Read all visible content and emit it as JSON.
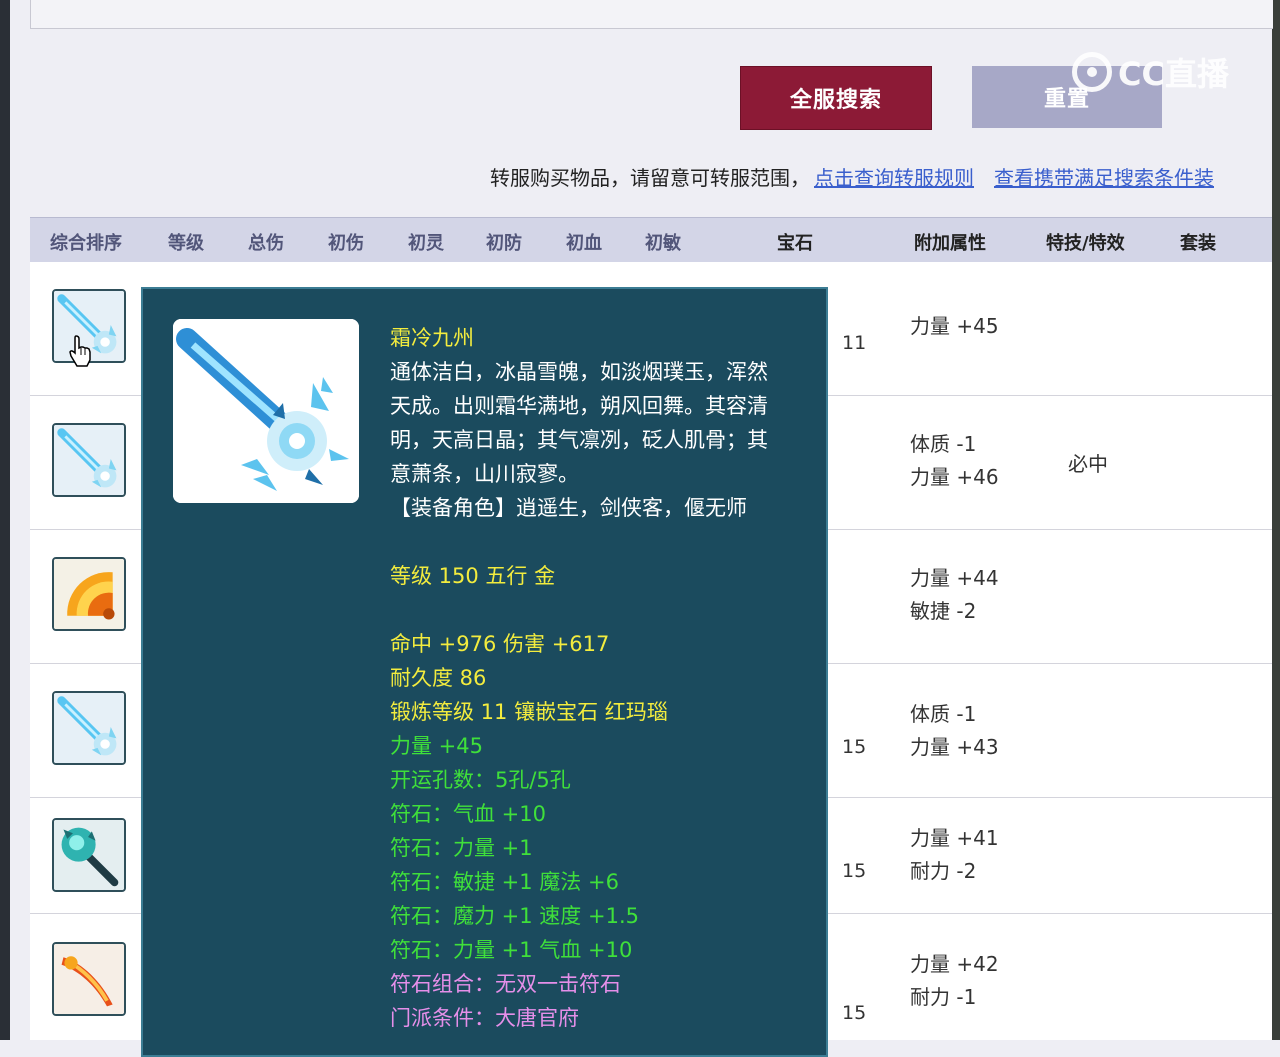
{
  "buttons": {
    "search": "全服搜索",
    "reset": "重置"
  },
  "watermark": "CC直播",
  "notice": {
    "text": "转服购买物品，请留意可转服范围，",
    "link1": "点击查询转服规则",
    "link2": "查看携带满足搜索条件装"
  },
  "columns": [
    "综合排序",
    "等级",
    "总伤",
    "初伤",
    "初灵",
    "初防",
    "初血",
    "初敏",
    "宝石",
    "附加属性",
    "特技/特效",
    "套装"
  ],
  "rows": [
    {
      "icon": "ice-sword-icon",
      "gem": "11",
      "attrs": [
        "力量 +45"
      ],
      "special": ""
    },
    {
      "icon": "ice-sword-icon",
      "gem": "",
      "attrs": [
        "体质 -1",
        "力量 +46"
      ],
      "special": "必中"
    },
    {
      "icon": "golden-fan-icon",
      "gem": "",
      "attrs": [
        "力量 +44",
        "敏捷 -2"
      ],
      "special": ""
    },
    {
      "icon": "ice-sword-icon",
      "gem": "15",
      "attrs": [
        "体质 -1",
        "力量 +43"
      ],
      "special": ""
    },
    {
      "icon": "jade-hammer-icon",
      "gem": "15",
      "attrs": [
        "力量 +41",
        "耐力 -2"
      ],
      "special": ""
    },
    {
      "icon": "fire-sword-icon",
      "gem": "15",
      "attrs": [
        "力量 +42",
        "耐力 -1"
      ],
      "special": ""
    }
  ],
  "tooltip": {
    "name": "霜冷九州",
    "description": [
      "通体洁白，冰晶雪魄，如淡烟璞玉，浑然",
      "天成。出则霜华满地，朔风回舞。其容清",
      "明，天高日晶；其气凛冽，砭人肌骨；其",
      "意萧条，山川寂寥。"
    ],
    "roles": "【装备角色】逍遥生，剑侠客，偃无师",
    "level": "等级 150 五行 金",
    "stats": "命中 +976 伤害 +617",
    "durability": "耐久度 86",
    "forge": "锻炼等级 11 镶嵌宝石 红玛瑙",
    "strength": "力量 +45",
    "holes": "开运孔数：5孔/5孔",
    "runes": [
      "符石：气血 +10",
      "符石：力量 +1",
      "符石：敏捷 +1 魔法 +6",
      "符石：魔力 +1 速度 +1.5",
      "符石：力量 +1 气血 +10"
    ],
    "rune_combo": "符石组合：无双一击符石",
    "school": "门派条件：大唐官府"
  },
  "colors": {
    "search_btn": "#8c1a36",
    "reset_btn": "#a7a8c7",
    "tooltip_bg": "#1b4b5e",
    "link": "#3a5fcd"
  }
}
